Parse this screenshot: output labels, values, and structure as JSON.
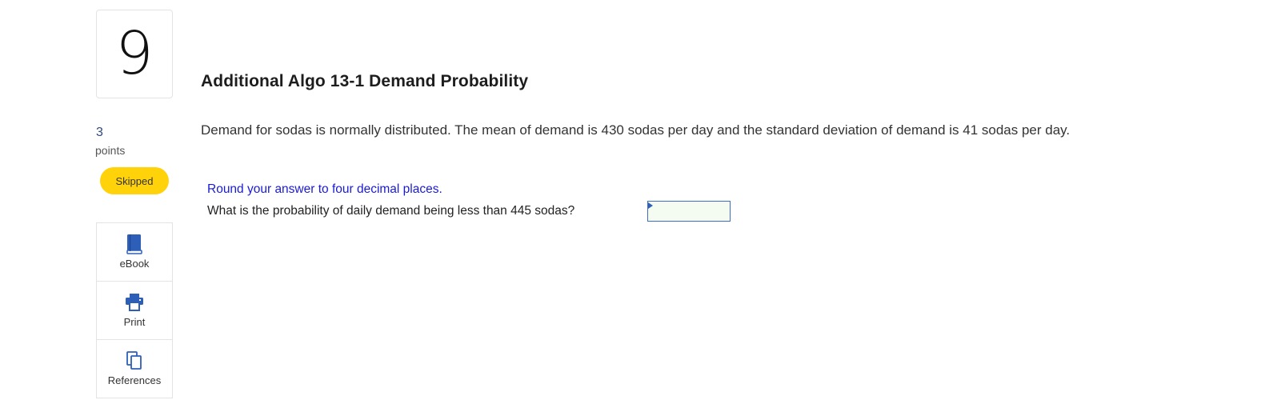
{
  "question": {
    "number": "9",
    "points_value": "3",
    "points_label": "points",
    "status": "Skipped",
    "status_color": "#ffd20a",
    "title": "Additional Algo 13-1 Demand Probability",
    "body": "Demand for sodas is normally distributed. The mean of demand is 430 sodas per day and the standard deviation of demand is 41 sodas per day.",
    "instruction": "Round your answer to four decimal places.",
    "prompt": "What is the probability of daily demand being less than 445 sodas?",
    "answer_value": ""
  },
  "tools": [
    {
      "label": "eBook",
      "icon": "book-icon"
    },
    {
      "label": "Print",
      "icon": "printer-icon"
    },
    {
      "label": "References",
      "icon": "copy-icon"
    }
  ],
  "colors": {
    "accent_blue": "#3b6cc9",
    "instruction_blue": "#1a1ad6",
    "icon_blue": "#2e5fb8"
  }
}
